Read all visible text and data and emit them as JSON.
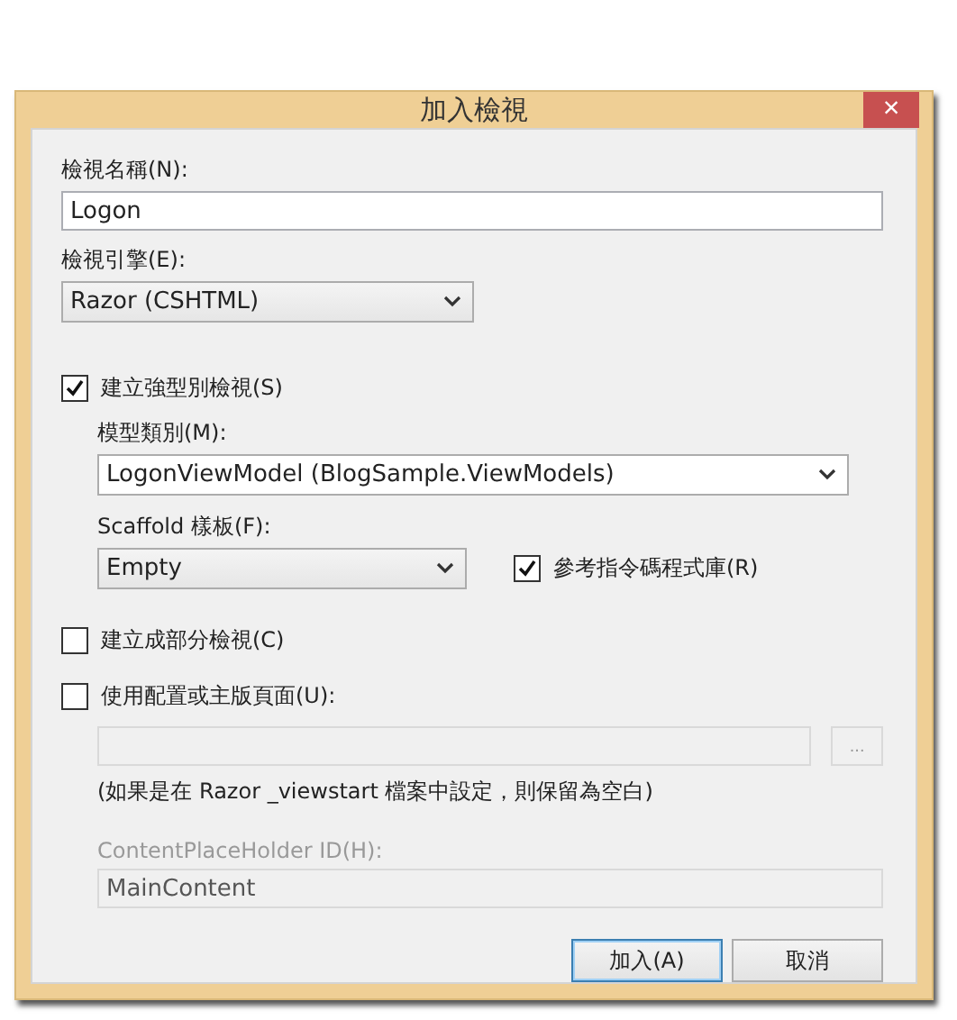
{
  "window": {
    "title": "加入檢視",
    "close": "×"
  },
  "view_name": {
    "label": "檢視名稱(N):",
    "value": "Logon"
  },
  "view_engine": {
    "label": "檢視引擎(E):",
    "value": "Razor (CSHTML)"
  },
  "strongly_typed": {
    "label": "建立強型別檢視(S)",
    "checked": true
  },
  "model_class": {
    "label": "模型類別(M):",
    "value": "LogonViewModel (BlogSample.ViewModels)"
  },
  "scaffold": {
    "label": "Scaffold 樣板(F):",
    "value": "Empty"
  },
  "script_libraries": {
    "label": "參考指令碼程式庫(R)",
    "checked": true
  },
  "partial_view": {
    "label": "建立成部分檢視(C)",
    "checked": false
  },
  "layout": {
    "label": "使用配置或主版頁面(U):",
    "checked": false,
    "browse": "...",
    "disabled": true
  },
  "layout_note": "(如果是在 Razor _viewstart 檔案中設定，則保留為空白)",
  "placeholder_id": {
    "label": "ContentPlaceHolder ID(H):",
    "value": "MainContent",
    "disabled": true
  },
  "buttons": [
    {
      "label": "加入(A)",
      "default": true
    },
    {
      "label": "取消",
      "default": false
    }
  ]
}
